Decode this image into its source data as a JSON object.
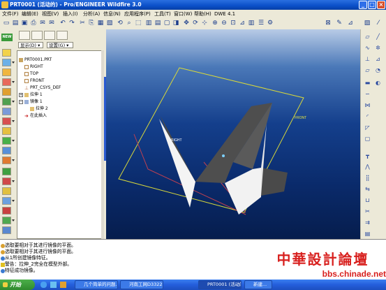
{
  "window": {
    "title": "PRT0001 (活动的) - Pro/ENGINEER Wildfire 3.0"
  },
  "menu": {
    "items": [
      "文件(F)",
      "编辑(E)",
      "视图(V)",
      "插入(I)",
      "分析(A)",
      "信息(N)",
      "应用程序(P)",
      "工具(T)",
      "窗口(W)",
      "帮助(H)",
      "DWE 4.1"
    ]
  },
  "left_toolbar": {
    "new_label": "NEW"
  },
  "model_tree": {
    "show_label": "显示(D) ▾",
    "settings_label": "设置(G) ▾",
    "nodes": [
      "PRT0001.PRT",
      "RIGHT",
      "TOP",
      "FRONT",
      "PRT_CSYS_DEF",
      "拉伸 1",
      "镜像 1",
      "拉伸 2",
      "在此插入"
    ]
  },
  "viewport": {
    "label_front": "FRONT",
    "label_right": "RIGHT"
  },
  "messages": [
    "选取要相对于其进行镜像的平面。",
    "选取要相对于其进行镜像的平面。",
    "从1所创建镜像特征。",
    "警告：拉伸_2完全在模型外部。",
    "特征成功镜像。"
  ],
  "taskbar": {
    "start_label": "开始",
    "tasks": [
      "几个简单的问题...",
      "河南工网D3322班...",
      "PRT0001 (活动的)...",
      "新建..."
    ]
  },
  "watermark": {
    "title": "中華設計論壇",
    "url": "bbs.chinade.net"
  },
  "colors": {
    "titlebar": "#0a4fc8",
    "viewport_top": "#b8cbe6",
    "viewport_bottom": "#061d4d",
    "plane_outline": "#d8d83a",
    "model_dark": "#4a4a4a",
    "model_light": "#ffffff",
    "watermark_red": "#d8201e"
  }
}
